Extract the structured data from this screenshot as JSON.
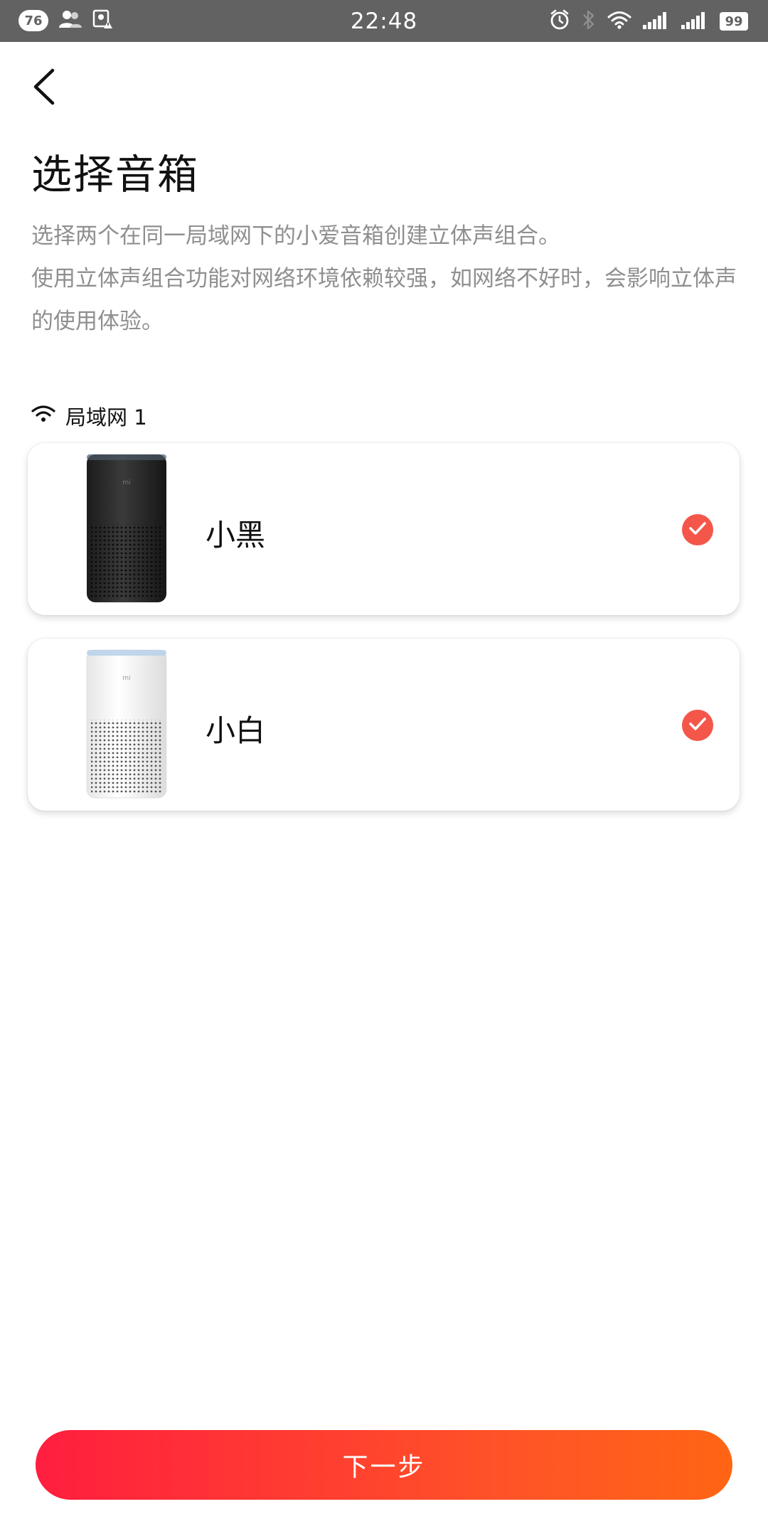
{
  "status_bar": {
    "badge": "76",
    "time": "22:48",
    "battery": "99",
    "icons": [
      "user-icon",
      "photo-alert-icon",
      "alarm-icon",
      "bluetooth-icon",
      "wifi-icon",
      "signal-icon",
      "signal-icon"
    ]
  },
  "header": {
    "back_icon": "chevron-left-icon",
    "title": "选择音箱",
    "desc_line1": "选择两个在同一局域网下的小爱音箱创建立体声组合。",
    "desc_line2": "使用立体声组合功能对网络环境依赖较强，如网络不好时，会影响立体声的使用体验。"
  },
  "network": {
    "icon": "wifi-icon",
    "label": "局域网 1"
  },
  "speakers": [
    {
      "name": "小黑",
      "color": "#2a2a2a",
      "selected": true
    },
    {
      "name": "小白",
      "color": "#f2f2f2",
      "selected": true
    }
  ],
  "accent_color": "#f4574a",
  "next_button": {
    "label": "下一步"
  }
}
